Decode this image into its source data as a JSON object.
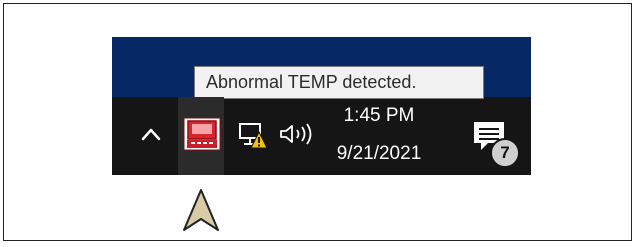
{
  "tooltip": {
    "text": "Abnormal TEMP detected."
  },
  "tray": {
    "icons": [
      "chevron-up-icon",
      "temperature-monitor-app-icon",
      "network-warning-icon",
      "volume-icon",
      "action-center-icon"
    ]
  },
  "clock": {
    "time": "1:45 PM",
    "date": "9/21/2021"
  },
  "notifications": {
    "count": "7"
  },
  "colors": {
    "desktop": "#062864",
    "taskbar": "#151515",
    "tooltip_background": "#f2f2f2",
    "warning": "#f5c400",
    "app_red": "#d9252f",
    "pointer_fill": "#d8cba6"
  }
}
